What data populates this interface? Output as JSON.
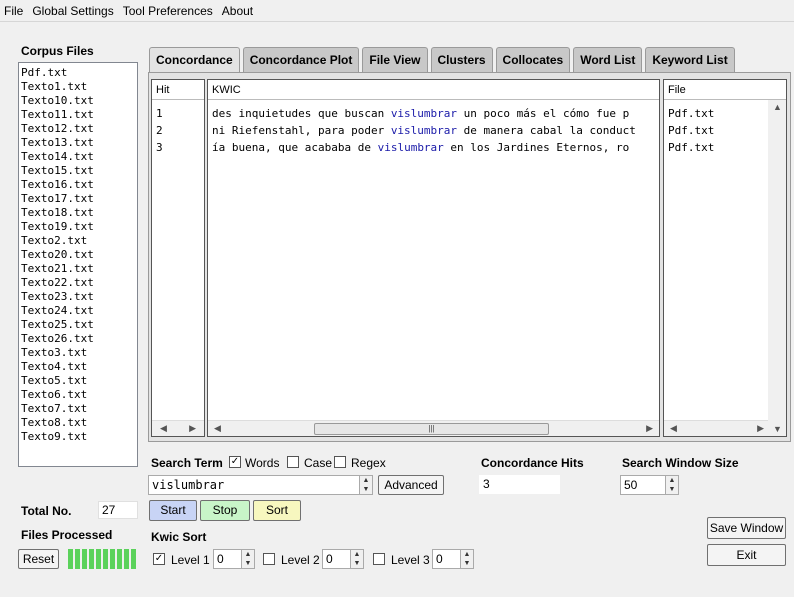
{
  "menu": [
    "File",
    "Global Settings",
    "Tool Preferences",
    "About"
  ],
  "corpus": {
    "title": "Corpus Files",
    "files": [
      "Pdf.txt",
      "Texto1.txt",
      "Texto10.txt",
      "Texto11.txt",
      "Texto12.txt",
      "Texto13.txt",
      "Texto14.txt",
      "Texto15.txt",
      "Texto16.txt",
      "Texto17.txt",
      "Texto18.txt",
      "Texto19.txt",
      "Texto2.txt",
      "Texto20.txt",
      "Texto21.txt",
      "Texto22.txt",
      "Texto23.txt",
      "Texto24.txt",
      "Texto25.txt",
      "Texto26.txt",
      "Texto3.txt",
      "Texto4.txt",
      "Texto5.txt",
      "Texto6.txt",
      "Texto7.txt",
      "Texto8.txt",
      "Texto9.txt"
    ],
    "total_label": "Total No.",
    "total_value": "27",
    "processed_label": "Files Processed",
    "reset_label": "Reset"
  },
  "tabs": [
    "Concordance",
    "Concordance Plot",
    "File View",
    "Clusters",
    "Collocates",
    "Word List",
    "Keyword List"
  ],
  "concordance": {
    "headers": {
      "hit": "Hit",
      "kwic": "KWIC",
      "file": "File"
    },
    "rows": [
      {
        "hit": "1",
        "left": "des inquietudes que buscan ",
        "kw": "vislumbrar",
        "right": " un  poco más el cómo fue p",
        "file": "Pdf.txt"
      },
      {
        "hit": "2",
        "left": "ni Riefenstahl, para poder ",
        "kw": "vislumbrar",
        "right": " de manera cabal la conduct",
        "file": "Pdf.txt"
      },
      {
        "hit": "3",
        "left": "ía buena, que acababa de ",
        "kw": "vislumbrar",
        "right": " en los Jardines  Eternos, ro",
        "file": "Pdf.txt"
      }
    ]
  },
  "search": {
    "term_label": "Search Term",
    "words_label": "Words",
    "case_label": "Case",
    "regex_label": "Regex",
    "value": "vislumbrar",
    "advanced_label": "Advanced",
    "start_label": "Start",
    "stop_label": "Stop",
    "sort_label": "Sort"
  },
  "hits": {
    "label": "Concordance Hits",
    "value": "3"
  },
  "window_size": {
    "label": "Search Window Size",
    "value": "50"
  },
  "kwic_sort": {
    "title": "Kwic Sort",
    "levels": [
      {
        "label": "Level 1",
        "value": "0",
        "checked": true
      },
      {
        "label": "Level 2",
        "value": "0",
        "checked": false
      },
      {
        "label": "Level 3",
        "value": "0",
        "checked": false
      }
    ]
  },
  "buttons": {
    "save_window": "Save Window",
    "exit": "Exit"
  }
}
